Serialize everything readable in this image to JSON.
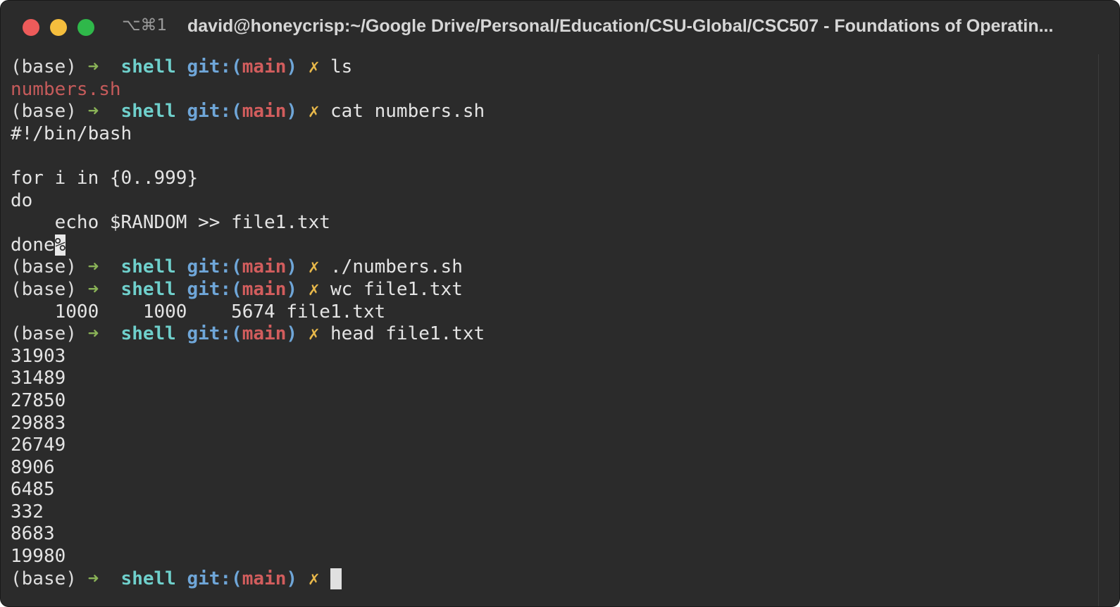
{
  "window": {
    "shortcut": "⌥⌘1",
    "title": "david@honeycrisp:~/Google Drive/Personal/Education/CSU-Global/CSC507 - Foundations of Operatin..."
  },
  "prompt": {
    "env": "(base)",
    "arrow": "➜",
    "dir": "shell",
    "git_prefix": "git:(",
    "branch": "main",
    "git_suffix": ")",
    "dirty_mark": "✗"
  },
  "commands": {
    "ls": "ls",
    "cat": "cat numbers.sh",
    "run": "./numbers.sh",
    "wc": "wc file1.txt",
    "head": "head file1.txt"
  },
  "output": {
    "ls_result": "numbers.sh",
    "script_lines": [
      "#!/bin/bash",
      "",
      "for i in {0..999}",
      "do",
      "    echo $RANDOM >> file1.txt",
      "done"
    ],
    "no_newline_marker": "%",
    "wc_result": "    1000    1000    5674 file1.txt",
    "head_values": [
      "31903",
      "31489",
      "27850",
      "29883",
      "26749",
      "8906",
      "6485",
      "332",
      "8683",
      "19980"
    ]
  },
  "colors": {
    "background": "#2b2b2b",
    "dir": "#6fd0cc",
    "git": "#6fa6d8",
    "branch": "#d25d5d",
    "dirty_mark": "#e8b84a",
    "arrow": "#8ab357"
  }
}
